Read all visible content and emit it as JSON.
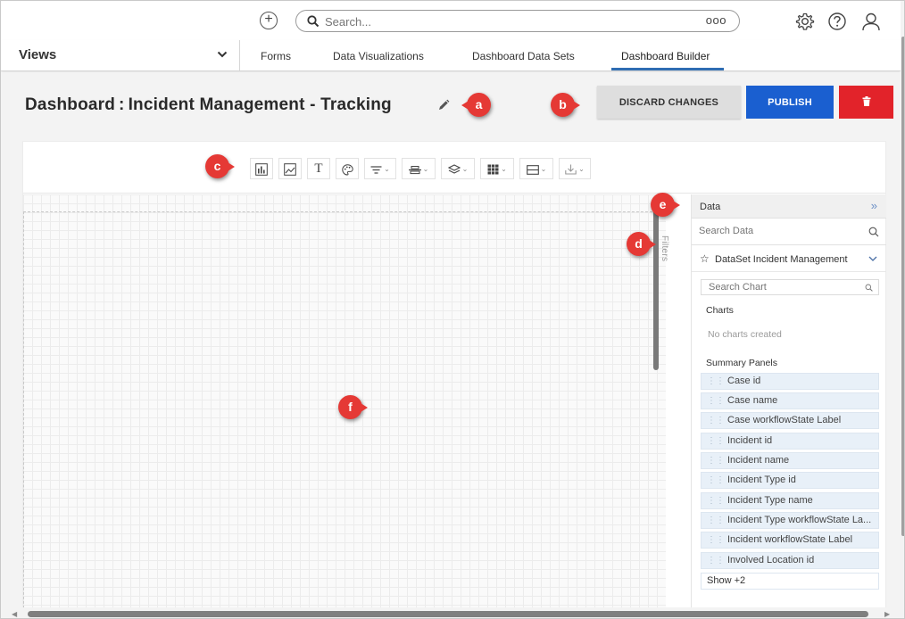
{
  "topbar": {
    "search_placeholder": "Search...",
    "more_icon": "ooo",
    "icons": [
      "add-circle-icon",
      "search-icon",
      "gear-icon",
      "help-icon",
      "user-icon"
    ]
  },
  "nav": {
    "views_label": "Views",
    "tabs": [
      {
        "label": "Forms"
      },
      {
        "label": "Data Visualizations"
      },
      {
        "label": "Dashboard Data Sets"
      },
      {
        "label": "Dashboard Builder",
        "active": true
      }
    ]
  },
  "page": {
    "title": "Dashboard : Incident Management - Tracking",
    "discard_label": "DISCARD CHANGES",
    "publish_label": "PUBLISH"
  },
  "callouts": {
    "a": "a",
    "b": "b",
    "c": "c",
    "d": "d",
    "e": "e",
    "f": "f"
  },
  "filters": {
    "label": "Filters"
  },
  "data_panel": {
    "header": "Data",
    "collapse_icon": "»",
    "search_placeholder": "Search Data",
    "dataset_name": "DataSet Incident Management",
    "chart_search_placeholder": "Search Chart",
    "charts_heading": "Charts",
    "no_charts": "No charts created",
    "summary_heading": "Summary Panels",
    "fields": [
      "Case id",
      "Case name",
      "Case workflowState Label",
      "Incident id",
      "Incident name",
      "Incident Type id",
      "Incident Type name",
      "Incident Type workflowState La...",
      "Incident workflowState Label",
      "Involved Location id"
    ],
    "show_more": "Show +2"
  },
  "colors": {
    "accent": "#2f6db3",
    "publish": "#1a5fd0",
    "delete": "#e2232a",
    "callout": "#e53935"
  }
}
